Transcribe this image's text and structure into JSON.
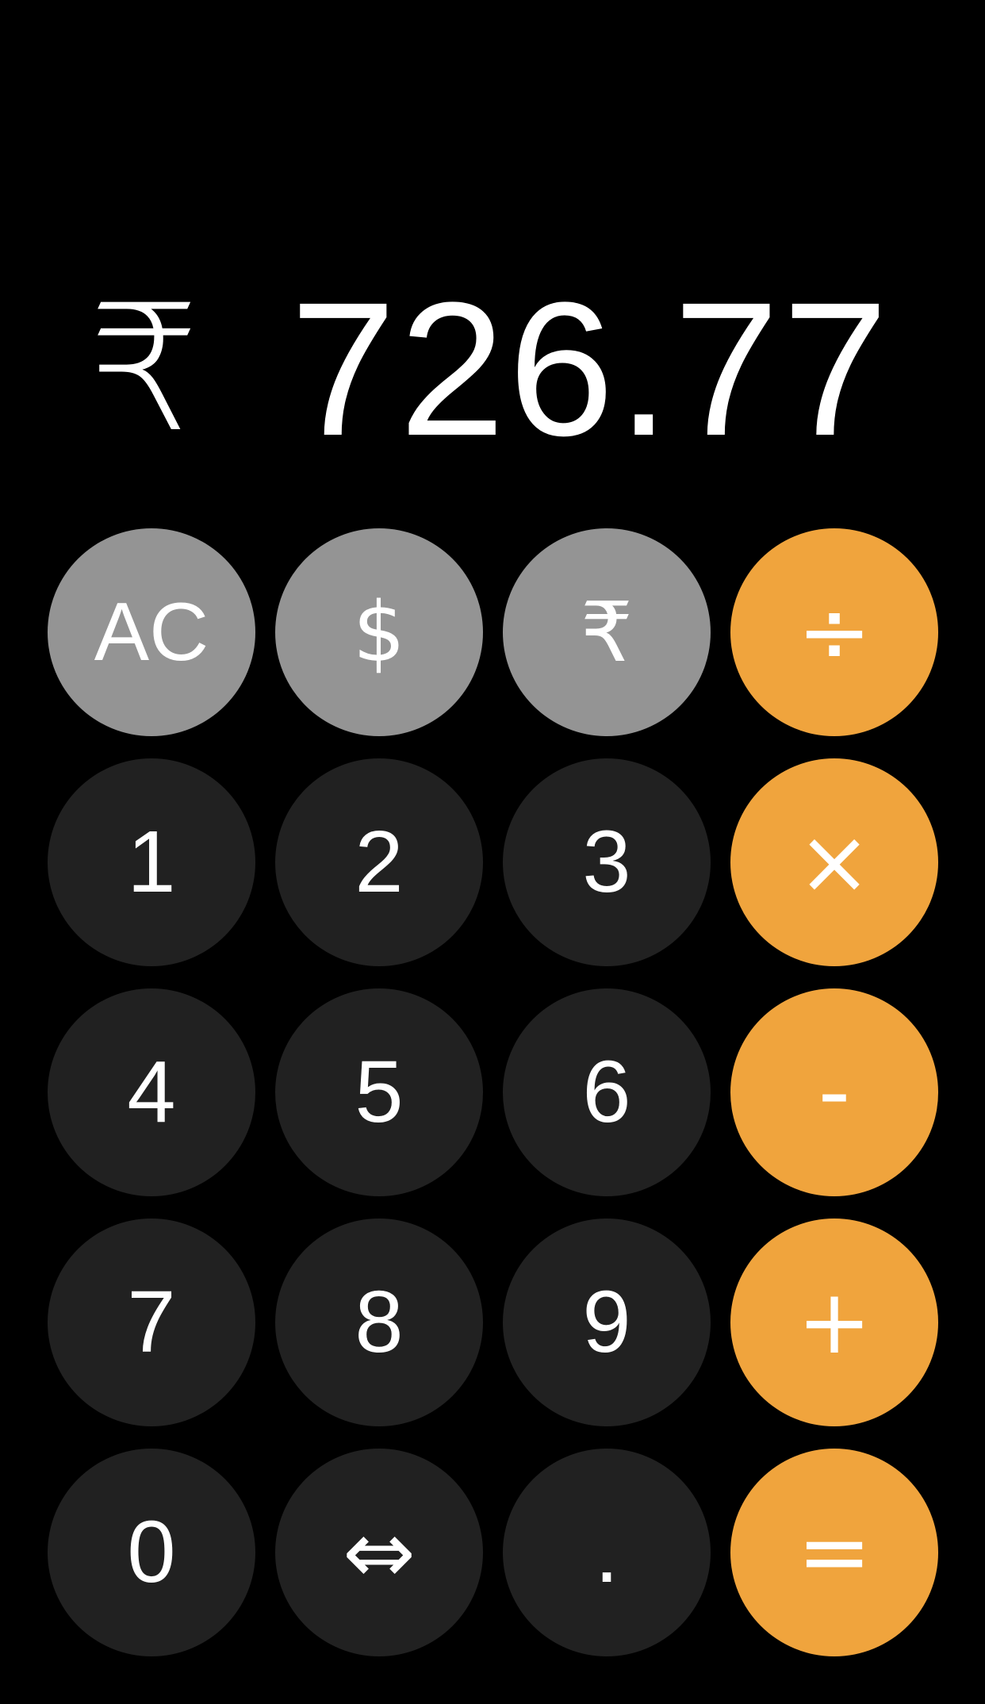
{
  "display": {
    "currency_symbol": "₹",
    "value": "726.77"
  },
  "keys": {
    "ac": "AC",
    "dollar": "$",
    "rupee": "₹",
    "divide": "÷",
    "one": "1",
    "two": "2",
    "three": "3",
    "multiply": "×",
    "four": "4",
    "five": "5",
    "six": "6",
    "subtract": "-",
    "seven": "7",
    "eight": "8",
    "nine": "9",
    "add": "+",
    "zero": "0",
    "swap": "⇔",
    "decimal": ".",
    "equals": "="
  },
  "colors": {
    "background": "#000000",
    "function_key": "#949494",
    "number_key": "#212121",
    "operator_key": "#f0a43d",
    "text": "#ffffff"
  }
}
